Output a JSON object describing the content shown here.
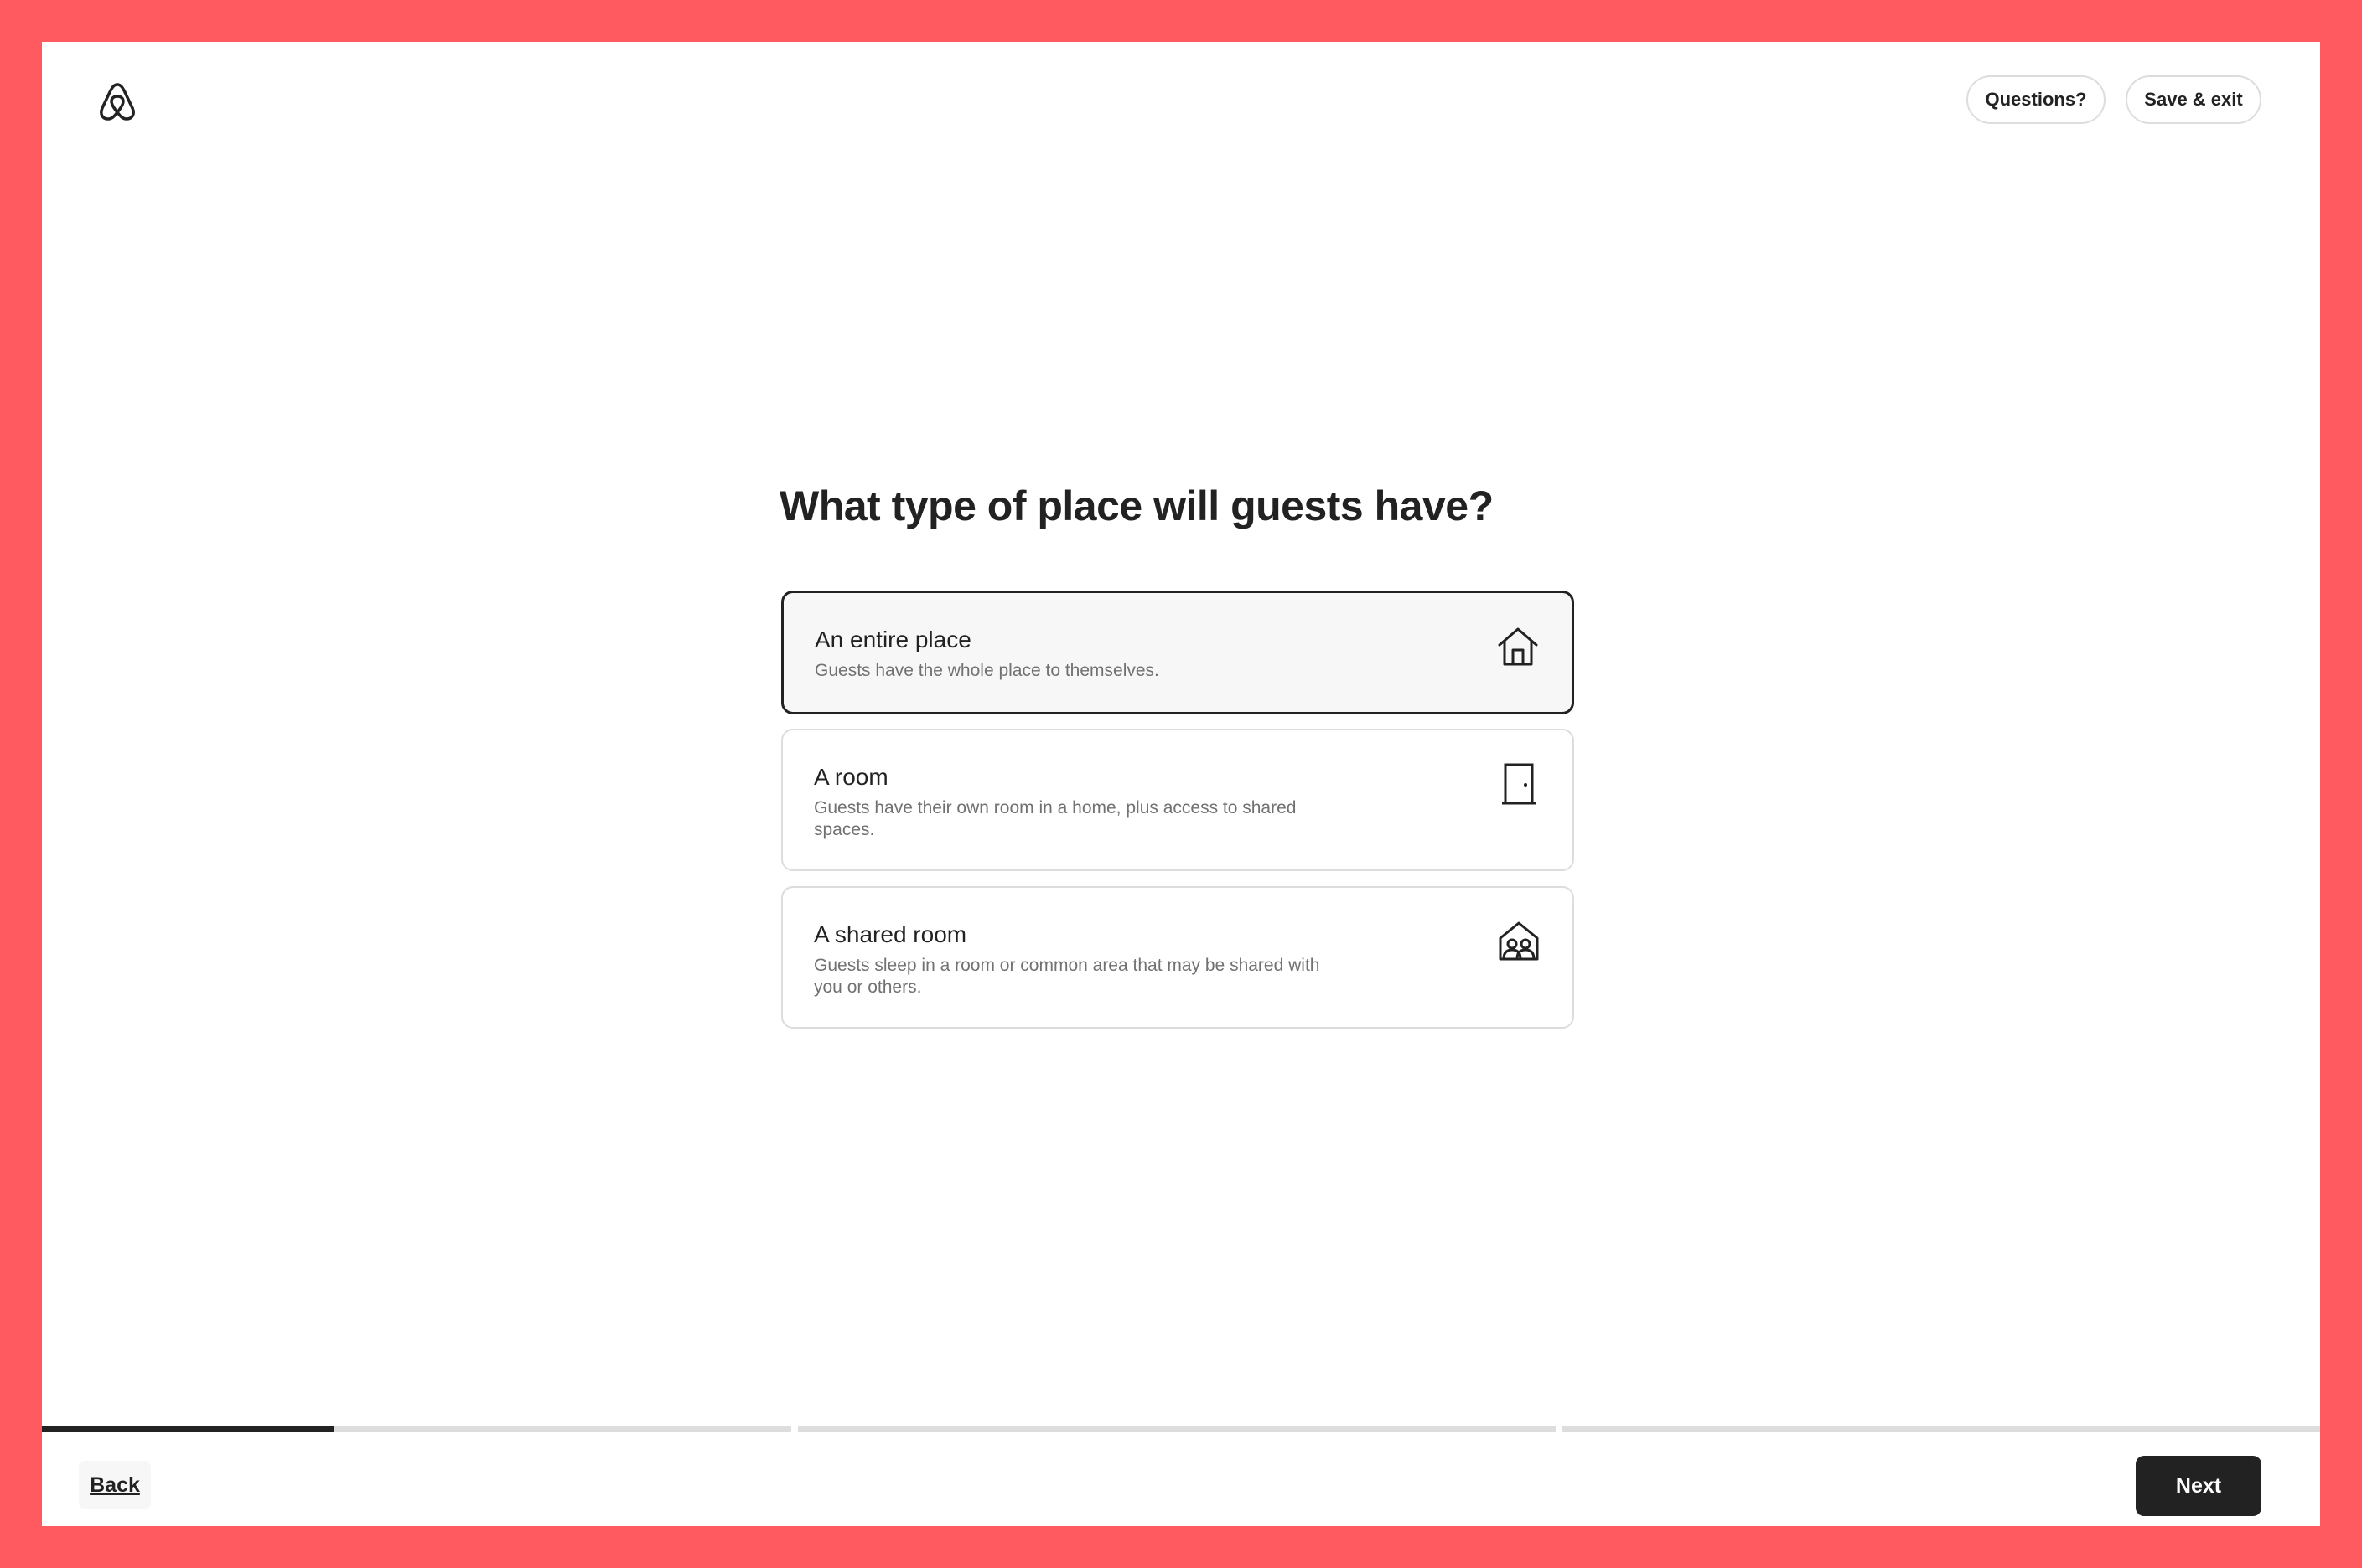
{
  "header": {
    "questions_label": "Questions?",
    "save_exit_label": "Save & exit"
  },
  "main": {
    "title": "What type of place will guests have?",
    "options": [
      {
        "title": "An entire place",
        "description": "Guests have the whole place to themselves.",
        "icon": "house-icon",
        "selected": true
      },
      {
        "title": "A room",
        "description": "Guests have their own room in a home, plus access to shared spaces.",
        "icon": "door-icon",
        "selected": false
      },
      {
        "title": "A shared room",
        "description": "Guests sleep in a room or common area that may be shared with you or others.",
        "icon": "shared-room-icon",
        "selected": false
      }
    ]
  },
  "footer": {
    "back_label": "Back",
    "next_label": "Next",
    "progress_segments": [
      0.39,
      0,
      0
    ]
  },
  "colors": {
    "brand": "#FF5A5F",
    "text": "#222222",
    "muted": "#717171",
    "border": "#dddddd"
  }
}
